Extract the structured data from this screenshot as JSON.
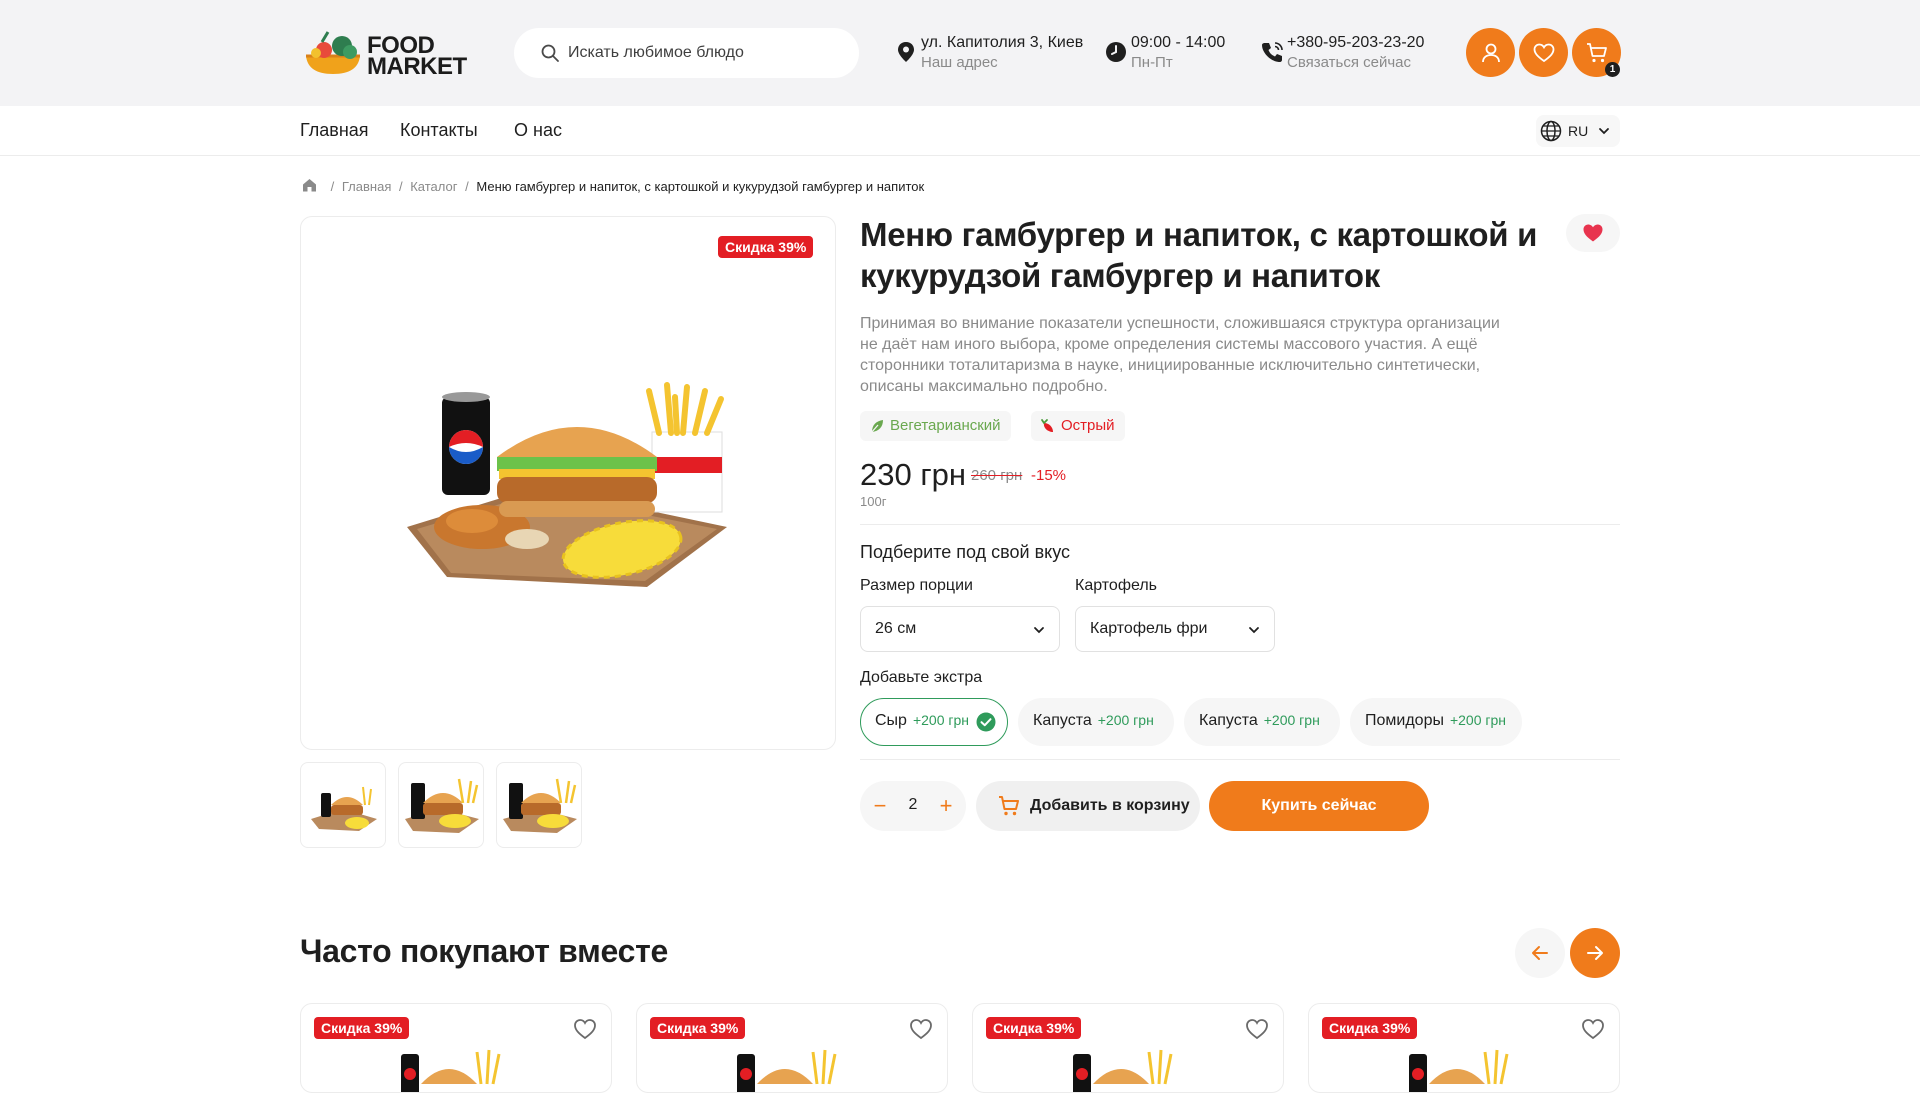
{
  "header": {
    "logo_line1": "FOOD",
    "logo_line2": "MARKET",
    "search_placeholder": "Искать любимое блюдо",
    "address": {
      "value": "ул. Капитолия 3, Киев",
      "caption": "Наш адрес"
    },
    "hours": {
      "value": "09:00 - 14:00",
      "caption": "Пн-Пт"
    },
    "phone": {
      "value": "+380-95-203-23-20",
      "caption": "Связаться сейчас"
    },
    "cart_count": "1",
    "accent_color": "#f07b1b"
  },
  "nav": {
    "items": [
      "Главная",
      "Контакты",
      "О нас"
    ],
    "language": "RU"
  },
  "breadcrumb": {
    "items": [
      "Главная",
      "Каталог"
    ],
    "current": "Меню гамбургер и напиток, с картошкой и кукурудзой гамбургер и напиток"
  },
  "product": {
    "discount_badge": "Скидка 39%",
    "title": "Меню гамбургер и напиток, с картошкой и кукурудзой гамбургер и напиток",
    "description": "Принимая во внимание показатели успешности, сложившаяся структура организации не даёт нам иного выбора, кроме определения системы массового участия. А ещё сторонники тоталитаризма в науке, инициированные исключительно синтетически, описаны максимально подробно.",
    "tags": [
      {
        "label": "Вегетарианский",
        "icon": "leaf-icon",
        "color": "#6aa84f"
      },
      {
        "label": "Острый",
        "icon": "chili-icon",
        "color": "#e31e24"
      }
    ],
    "price": "230 грн",
    "old_price": "260 грн",
    "discount_pct": "-15%",
    "weight": "100г",
    "customize_heading": "Подберите под свой вкус",
    "options": [
      {
        "label": "Размер порции",
        "value": "26 см"
      },
      {
        "label": "Картофель",
        "value": "Картофель фри"
      }
    ],
    "extras_label": "Добавьте экстра",
    "extras": [
      {
        "name": "Сыр",
        "price": "+200 грн",
        "selected": true
      },
      {
        "name": "Капуста",
        "price": "+200 грн",
        "selected": false
      },
      {
        "name": "Капуста",
        "price": "+200 грн",
        "selected": false
      },
      {
        "name": "Помидоры",
        "price": "+200 грн",
        "selected": false
      }
    ],
    "quantity": "2",
    "add_to_cart": "Добавить в корзину",
    "buy_now": "Купить сейчас",
    "thumbnail_count": 3
  },
  "related": {
    "title": "Часто покупают вместе",
    "cards": [
      {
        "badge": "Скидка 39%"
      },
      {
        "badge": "Скидка 39%"
      },
      {
        "badge": "Скидка 39%"
      },
      {
        "badge": "Скидка 39%"
      }
    ]
  }
}
